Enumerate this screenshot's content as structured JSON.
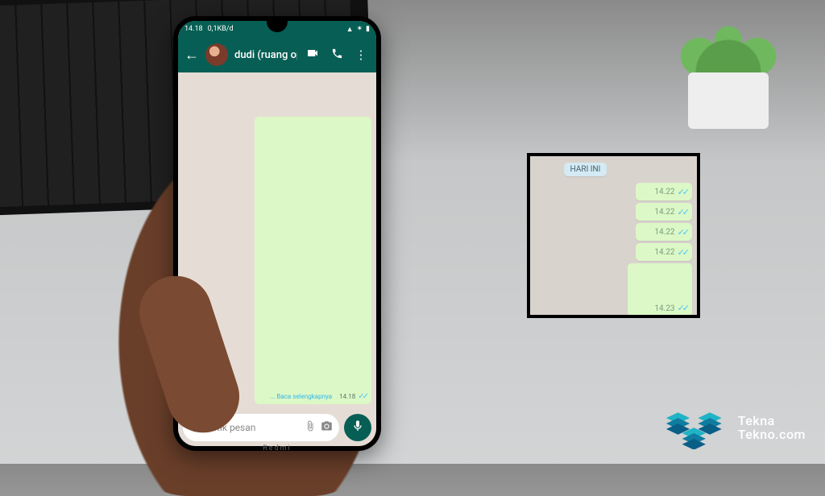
{
  "statusbar": {
    "time": "14.18",
    "net_speed": "0,1KB/d",
    "battery_icon": "▮"
  },
  "chat": {
    "contact_name": "dudi (ruang oprek)",
    "read_more": "... Baca selengkapnya",
    "bubble_time": "14.18",
    "input_placeholder": "Ketik pesan"
  },
  "phone_brand": "Redmi",
  "inset": {
    "date_label": "HARI INI",
    "messages": [
      {
        "time": "14.22"
      },
      {
        "time": "14.22"
      },
      {
        "time": "14.22"
      },
      {
        "time": "14.22"
      },
      {
        "time": "14.23",
        "tall": true
      }
    ]
  },
  "watermark": {
    "line1": "Tekna",
    "line2": "Tekno.com"
  }
}
